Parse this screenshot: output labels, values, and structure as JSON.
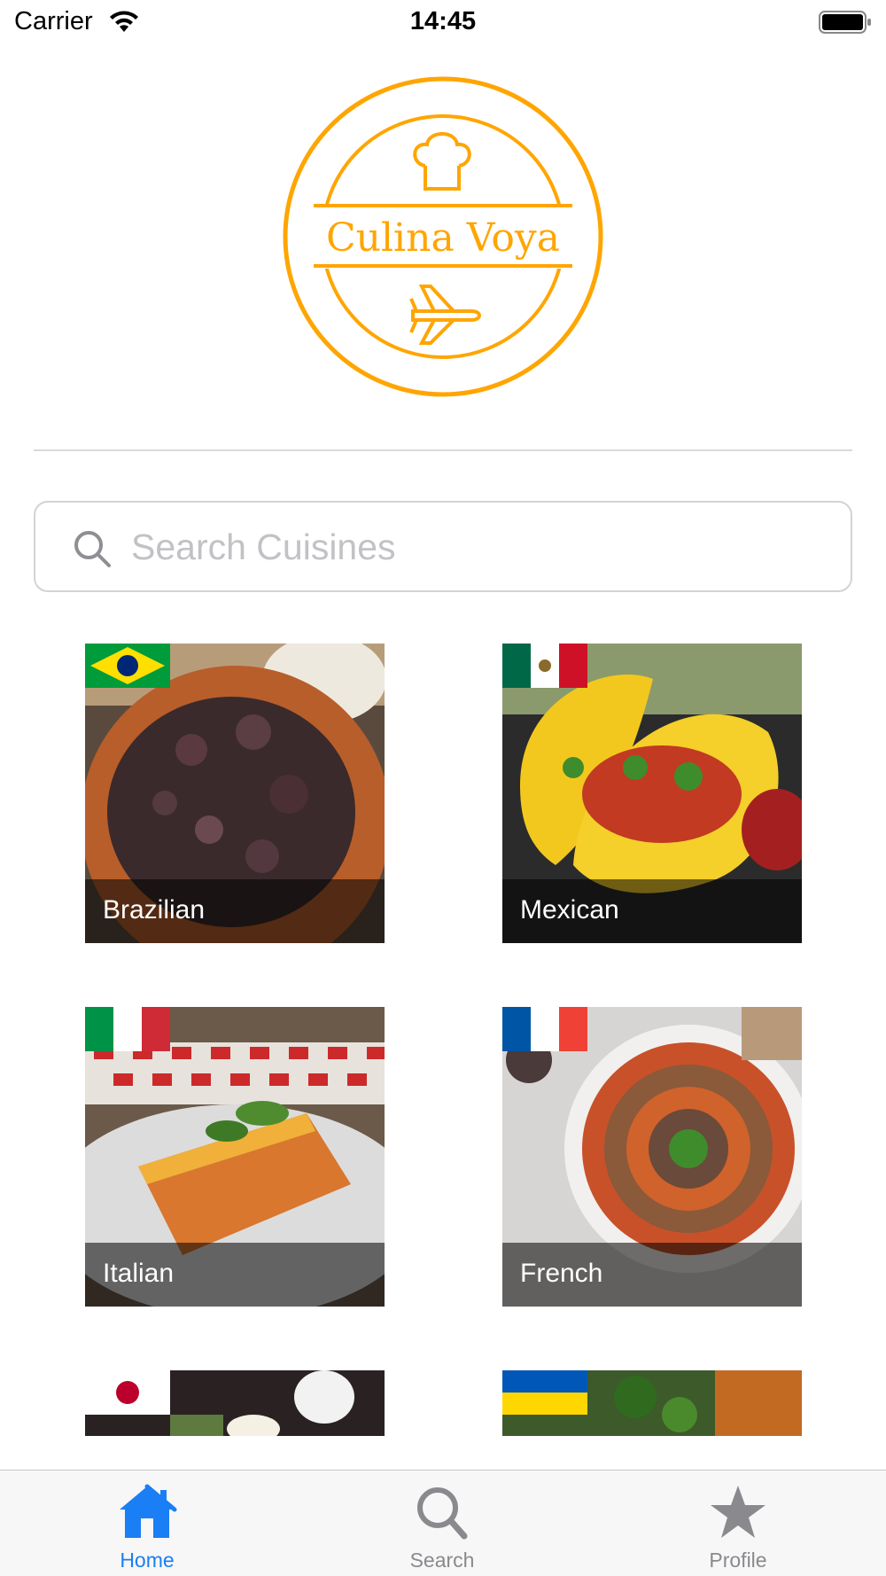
{
  "status_bar": {
    "carrier": "Carrier",
    "time": "14:45"
  },
  "logo": {
    "text": "Culina Voya",
    "color": "#FFA500"
  },
  "search": {
    "placeholder": "Search Cuisines",
    "value": ""
  },
  "cuisines": [
    {
      "name": "Brazilian",
      "flag": "brazil-flag"
    },
    {
      "name": "Mexican",
      "flag": "mexico-flag"
    },
    {
      "name": "Italian",
      "flag": "italy-flag"
    },
    {
      "name": "French",
      "flag": "france-flag"
    },
    {
      "name": "",
      "flag": "japan-flag"
    },
    {
      "name": "",
      "flag": "ukraine-flag"
    }
  ],
  "tab_bar": {
    "home": "Home",
    "search": "Search",
    "profile": "Profile",
    "active": "home",
    "active_color": "#1A7EF5",
    "inactive_color": "#8A8A8E"
  }
}
